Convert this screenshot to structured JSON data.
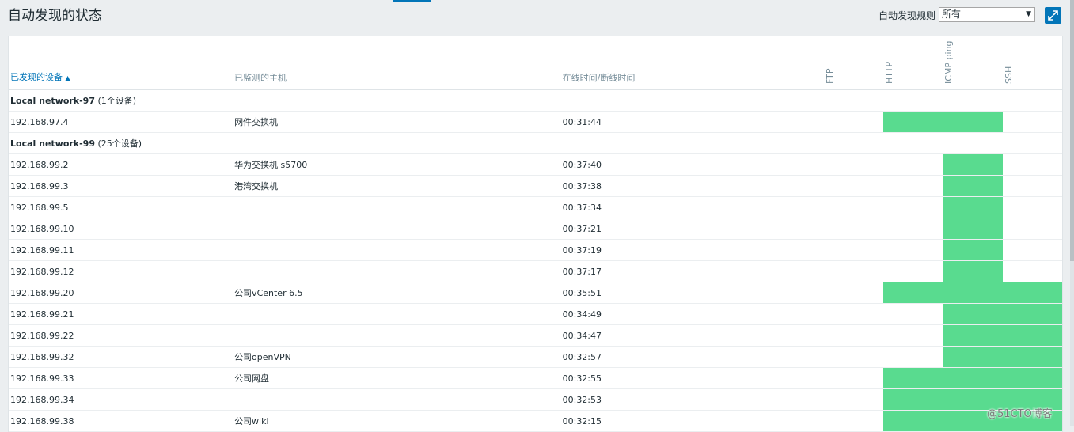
{
  "page": {
    "title": "自动发现的状态"
  },
  "filter": {
    "label": "自动发现规则",
    "value": "所有"
  },
  "columns": {
    "discovered": "已发现的设备",
    "monitored": "已监测的主机",
    "uptime": "在线时间/断线时间",
    "services": [
      "FTP",
      "HTTP",
      "ICMP ping",
      "SSH"
    ]
  },
  "groups": [
    {
      "name": "Local network-97",
      "count": "(1个设备)",
      "rows": [
        {
          "ip": "192.168.97.4",
          "host": "网件交换机",
          "time": "00:31:44",
          "svc": [
            false,
            true,
            true,
            false
          ]
        }
      ]
    },
    {
      "name": "Local network-99",
      "count": "(25个设备)",
      "rows": [
        {
          "ip": "192.168.99.2",
          "host": "华为交换机 s5700",
          "time": "00:37:40",
          "svc": [
            false,
            false,
            true,
            false
          ]
        },
        {
          "ip": "192.168.99.3",
          "host": "港湾交换机",
          "time": "00:37:38",
          "svc": [
            false,
            false,
            true,
            false
          ]
        },
        {
          "ip": "192.168.99.5",
          "host": "",
          "time": "00:37:34",
          "svc": [
            false,
            false,
            true,
            false
          ]
        },
        {
          "ip": "192.168.99.10",
          "host": "",
          "time": "00:37:21",
          "svc": [
            false,
            false,
            true,
            false
          ]
        },
        {
          "ip": "192.168.99.11",
          "host": "",
          "time": "00:37:19",
          "svc": [
            false,
            false,
            true,
            false
          ]
        },
        {
          "ip": "192.168.99.12",
          "host": "",
          "time": "00:37:17",
          "svc": [
            false,
            false,
            true,
            false
          ]
        },
        {
          "ip": "192.168.99.20",
          "host": "公司vCenter 6.5",
          "time": "00:35:51",
          "svc": [
            false,
            true,
            true,
            true
          ]
        },
        {
          "ip": "192.168.99.21",
          "host": "",
          "time": "00:34:49",
          "svc": [
            false,
            false,
            true,
            true
          ]
        },
        {
          "ip": "192.168.99.22",
          "host": "",
          "time": "00:34:47",
          "svc": [
            false,
            false,
            true,
            true
          ]
        },
        {
          "ip": "192.168.99.32",
          "host": "公司openVPN",
          "time": "00:32:57",
          "svc": [
            false,
            false,
            true,
            true
          ]
        },
        {
          "ip": "192.168.99.33",
          "host": "公司网盘",
          "time": "00:32:55",
          "svc": [
            false,
            true,
            true,
            true
          ]
        },
        {
          "ip": "192.168.99.34",
          "host": "",
          "time": "00:32:53",
          "svc": [
            false,
            true,
            true,
            true
          ]
        },
        {
          "ip": "192.168.99.38",
          "host": "公司wiki",
          "time": "00:32:15",
          "svc": [
            false,
            true,
            true,
            true
          ]
        }
      ]
    }
  ],
  "watermark": "@51CTO博客",
  "colors": {
    "up": "#59db8f",
    "accent": "#0275b8"
  }
}
